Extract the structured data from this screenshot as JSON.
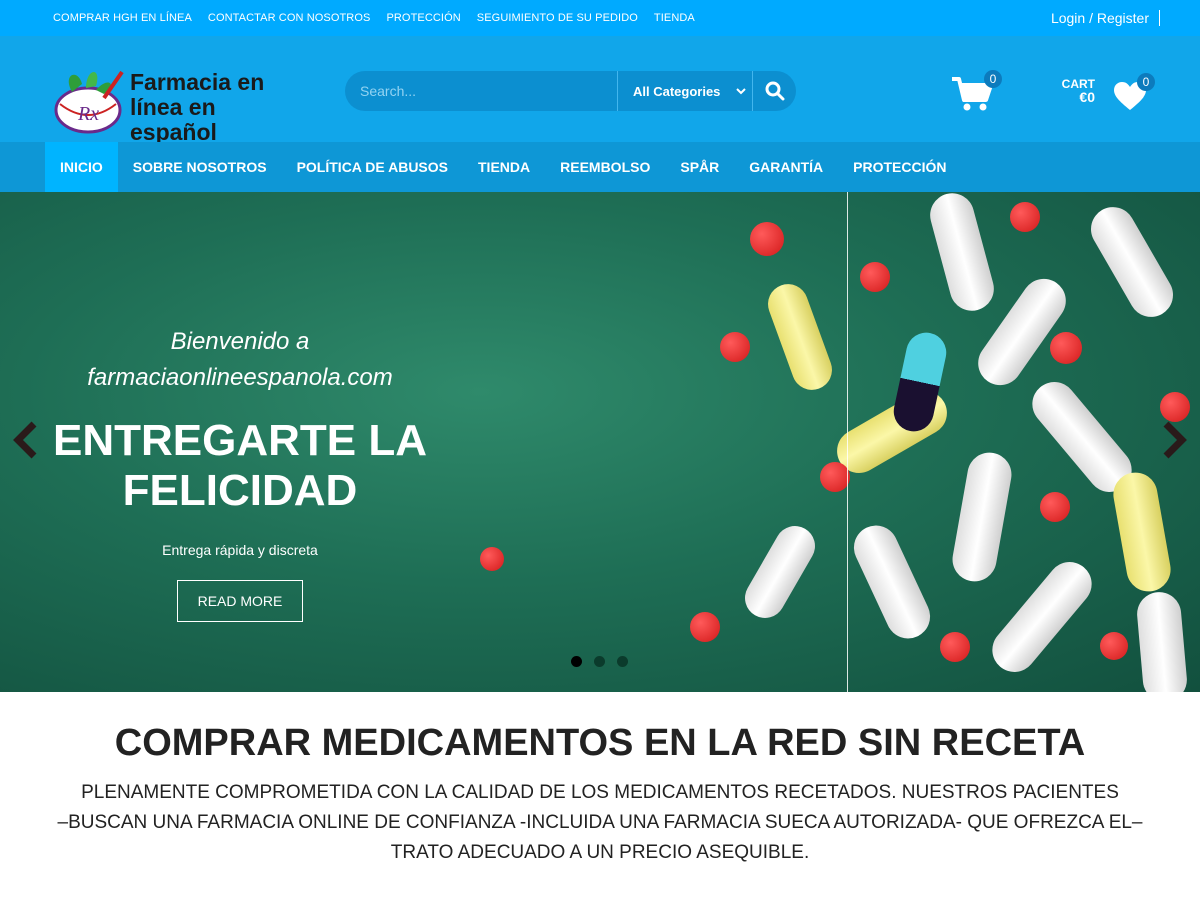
{
  "topbar": {
    "links": [
      "COMPRAR HGH EN LÍNEA",
      "CONTACTAR CON NOSOTROS",
      "PROTECCIÓN",
      "SEGUIMIENTO DE SU PEDIDO",
      "TIENDA"
    ],
    "login": "Login / Register"
  },
  "header": {
    "logo_text_line1": "Farmacia en",
    "logo_text_line2": "línea en español",
    "search_placeholder": "Search...",
    "category_selected": "All Categories",
    "cart_count": "0",
    "cart_label": "CART",
    "cart_amount": "€0",
    "wishlist_count": "0"
  },
  "nav": {
    "items": [
      "INICIO",
      "SOBRE NOSOTROS",
      "POLÍTICA DE ABUSOS",
      "TIENDA",
      "REEMBOLSO",
      "SPÅR",
      "GARANTÍA",
      "PROTECCIÓN"
    ]
  },
  "hero": {
    "welcome_line1": "Bienvenido a",
    "welcome_line2": "farmaciaonlineespanola.com",
    "headline_line1": "ENTREGARTE LA",
    "headline_line2": "FELICIDAD",
    "subtitle": "Entrega rápida y discreta",
    "button": "READ MORE"
  },
  "content": {
    "title": "COMPRAR MEDICAMENTOS EN LA RED SIN RECETA",
    "line1": "PLENAMENTE COMPROMETIDA CON LA CALIDAD DE LOS MEDICAMENTOS RECETADOS. NUESTROS PACIENTES",
    "line2": "–BUSCAN UNA FARMACIA ONLINE DE CONFIANZA -INCLUIDA UNA FARMACIA SUECA AUTORIZADA- QUE OFREZCA EL–",
    "line3": "TRATO ADECUADO A UN PRECIO ASEQUIBLE."
  },
  "colors": {
    "topbar": "#00aaff",
    "header": "#11a6ea",
    "nav": "#0e97d6",
    "nav_active": "#00b4ff"
  }
}
